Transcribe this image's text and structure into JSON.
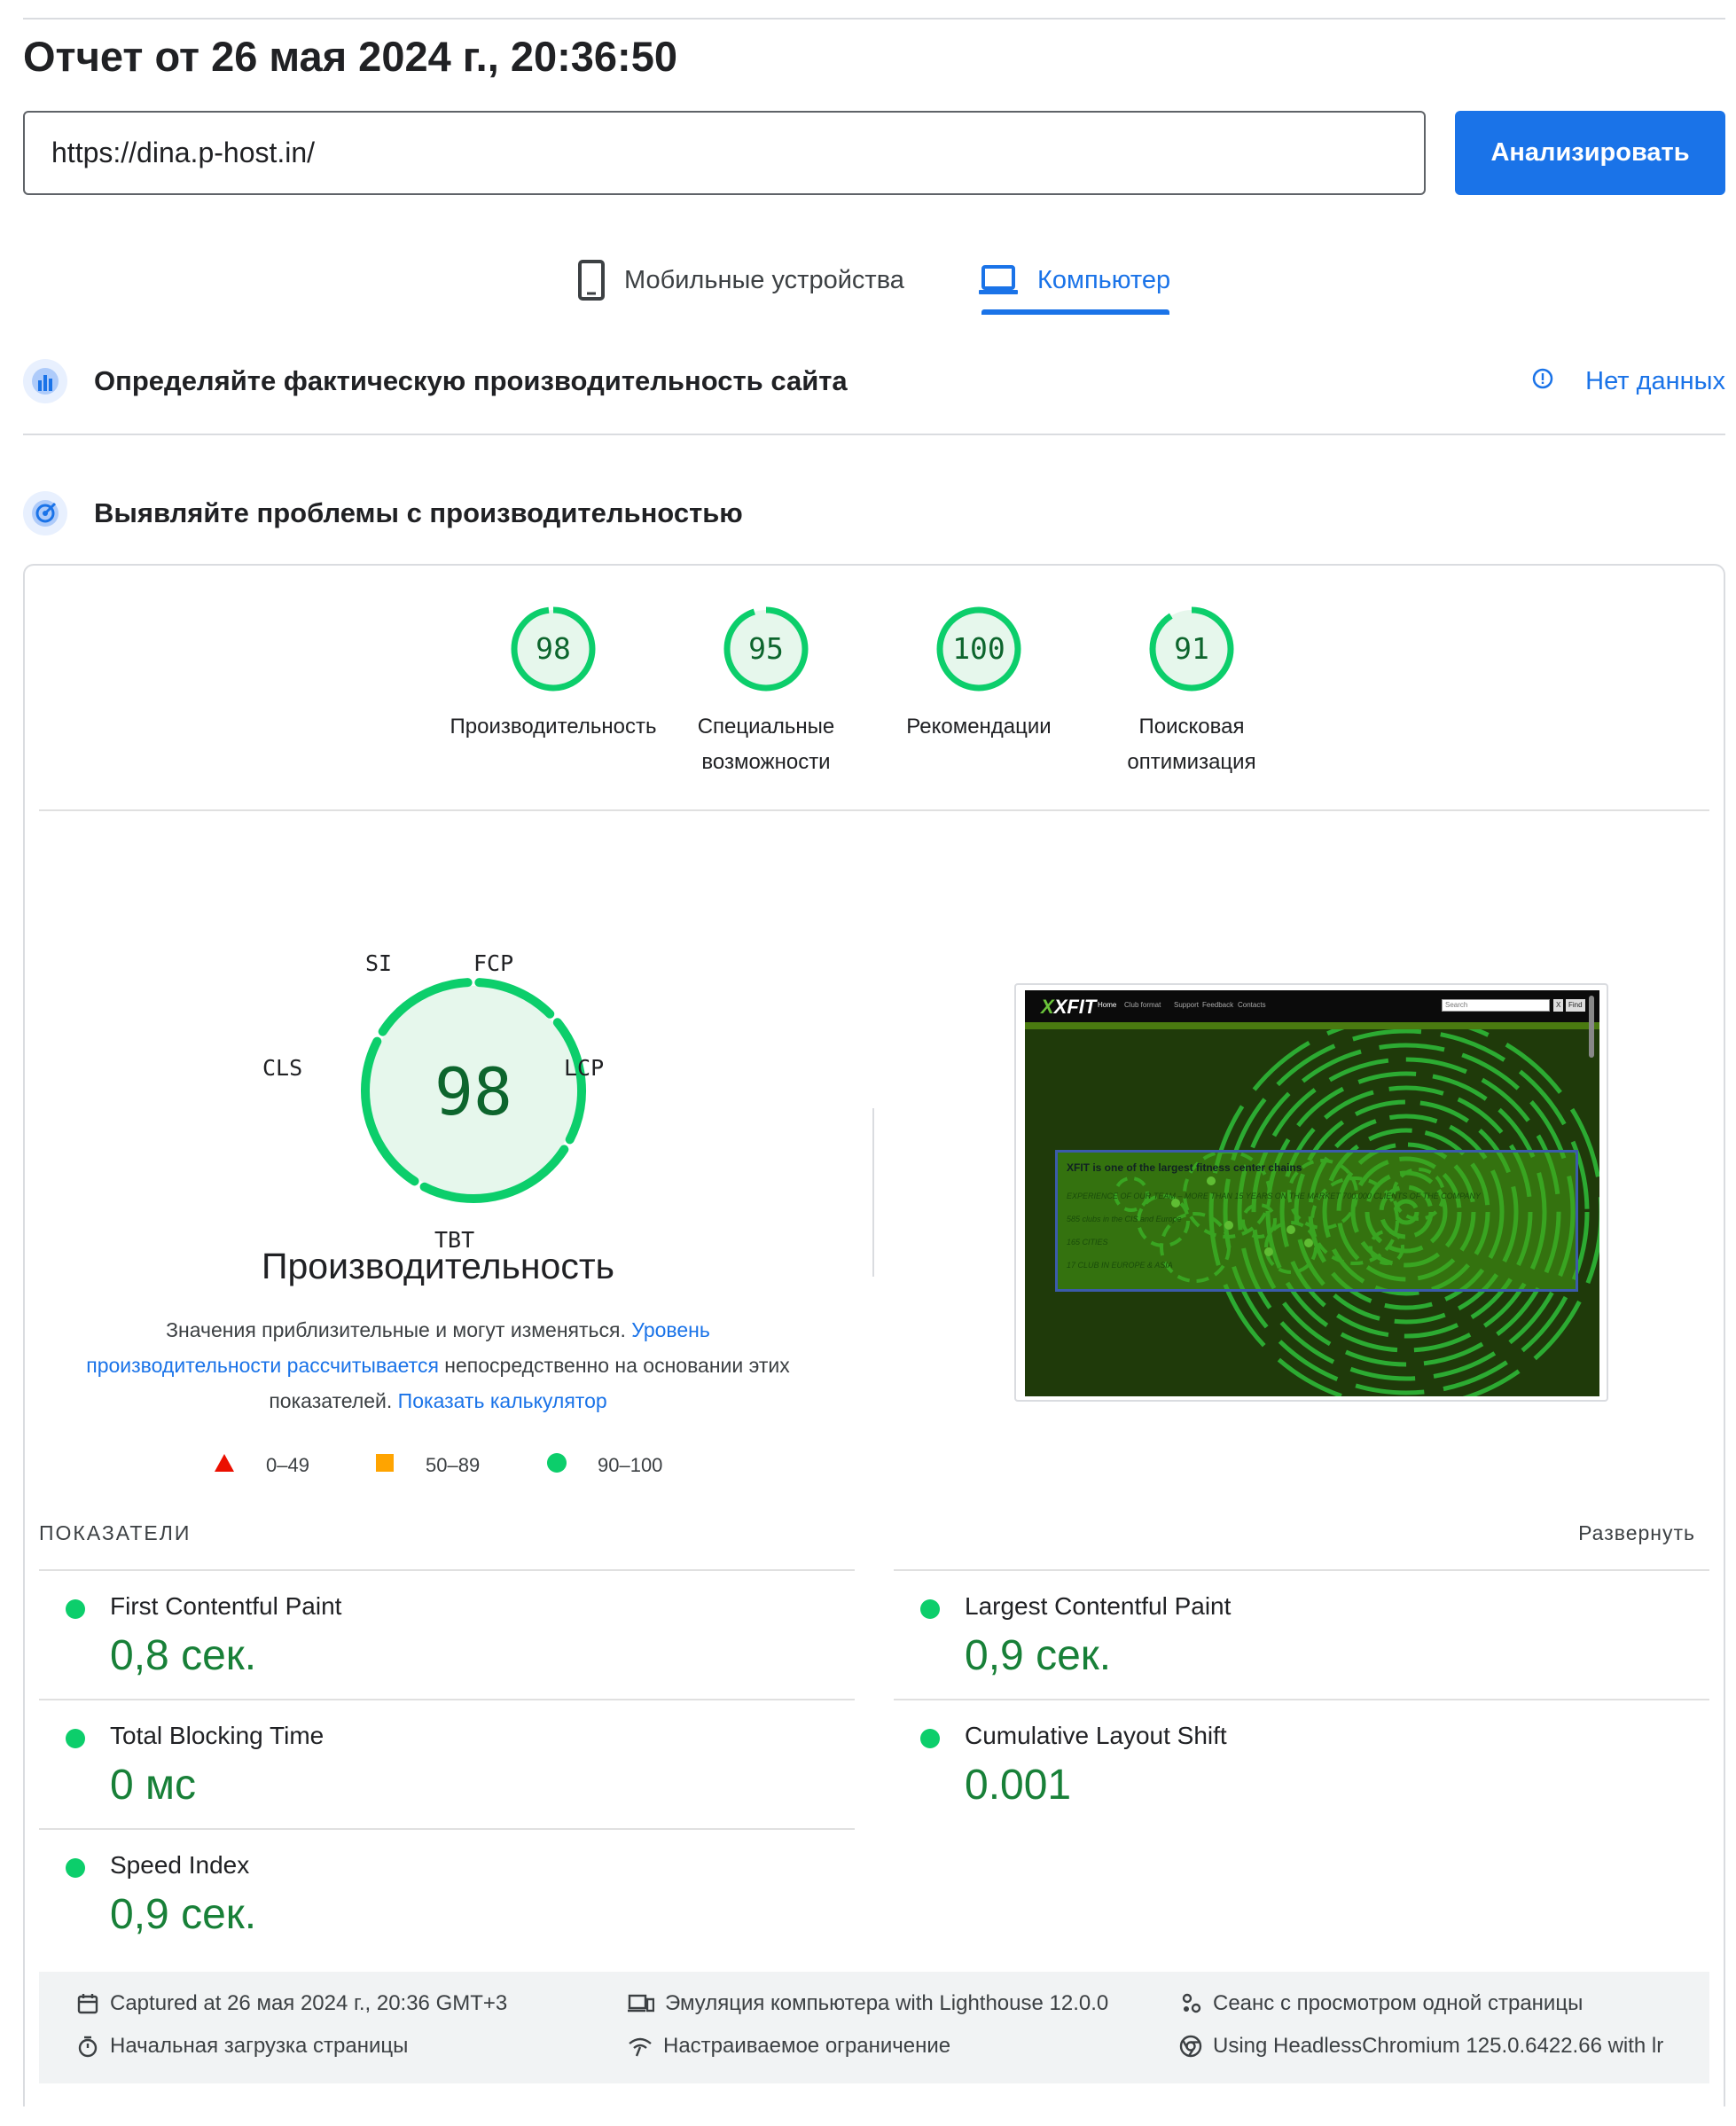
{
  "report": {
    "title": "Отчет от 26 мая 2024 г., 20:36:50",
    "url_value": "https://dina.p-host.in/",
    "analyze_label": "Анализировать"
  },
  "tabs": [
    {
      "label": "Мобильные устройства",
      "icon": "phone-icon",
      "active": false
    },
    {
      "label": "Компьютер",
      "icon": "laptop-icon",
      "active": true
    }
  ],
  "sections": {
    "field_data": {
      "heading": "Определяйте фактическую производительность сайта",
      "status": "Нет данных"
    },
    "lab_data": {
      "heading": "Выявляйте проблемы с производительностью"
    }
  },
  "scores": [
    {
      "value": "98",
      "label_line1": "Производительность",
      "label_line2": ""
    },
    {
      "value": "95",
      "label_line1": "Специальные",
      "label_line2": "возможности"
    },
    {
      "value": "100",
      "label_line1": "Рекомендации",
      "label_line2": ""
    },
    {
      "value": "91",
      "label_line1": "Поисковая",
      "label_line2": "оптимизация"
    }
  ],
  "performance": {
    "score": "98",
    "title": "Производительность",
    "metric_labels": {
      "si": "SI",
      "fcp": "FCP",
      "lcp": "LCP",
      "tbt": "TBT",
      "cls": "CLS"
    },
    "desc_part1": "Значения приблизительные и могут изменяться. ",
    "desc_link1": "Уровень производительности рассчитывается",
    "desc_part2": " непосредственно на основании этих показателей. ",
    "desc_link2": "Показать калькулятор"
  },
  "legend": [
    {
      "range": "0–49",
      "shape": "triangle",
      "color": "#eb0f00"
    },
    {
      "range": "50–89",
      "shape": "square",
      "color": "#ffa400"
    },
    {
      "range": "90–100",
      "shape": "circle",
      "color": "#0cce6b"
    }
  ],
  "screenshot": {
    "logo": "XFIT",
    "nav": [
      "Home",
      "Club format",
      "Support",
      "Feedback",
      "Contacts"
    ],
    "search_placeholder": "Search",
    "search_btn_x": "X",
    "search_btn_find": "Find",
    "headline": "XFIT is one of the largest fitness center chains",
    "lines": [
      "EXPERIENCE OF OUR TEAM – MORE THAN 15 YEARS ON THE MARKET 700,000 CLIENTS OF THE COMPANY",
      "585 clubs in the CIS and Europe",
      "165 CITIES",
      "17 CLUB IN EUROPE & ASIA"
    ]
  },
  "metrics_header": "ПОКАЗАТЕЛИ",
  "expand_label": "Развернуть",
  "metrics": [
    {
      "name": "First Contentful Paint",
      "value": "0,8 сек.",
      "color": "#0cce6b"
    },
    {
      "name": "Largest Contentful Paint",
      "value": "0,9 сек.",
      "color": "#0cce6b"
    },
    {
      "name": "Total Blocking Time",
      "value": "0 мс",
      "color": "#0cce6b"
    },
    {
      "name": "Cumulative Layout Shift",
      "value": "0.001",
      "color": "#0cce6b"
    },
    {
      "name": "Speed Index",
      "value": "0,9 сек.",
      "color": "#0cce6b"
    }
  ],
  "footer": {
    "captured": "Captured at 26 мая 2024 г., 20:36 GMT+3",
    "emulation": "Эмуляция компьютера with Lighthouse 12.0.0",
    "session": "Сеанс с просмотром одной страницы",
    "load": "Начальная загрузка страницы",
    "throttling": "Настраиваемое ограничение",
    "browser": "Using HeadlessChromium 125.0.6422.66 with lr"
  },
  "colors": {
    "accent": "#1a73e8",
    "pass": "#0cce6b",
    "pass_text": "#188038"
  }
}
